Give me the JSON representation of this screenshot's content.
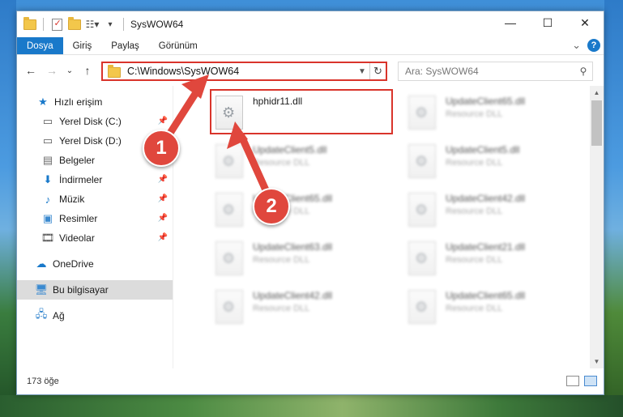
{
  "window": {
    "title": "SysWOW64",
    "controls": {
      "minimize": "—",
      "maximize": "☐",
      "close": "✕"
    }
  },
  "ribbon": {
    "tabs": [
      {
        "label": "Dosya",
        "active": true
      },
      {
        "label": "Giriş"
      },
      {
        "label": "Paylaş"
      },
      {
        "label": "Görünüm"
      }
    ],
    "expand": "⌄",
    "help": "?"
  },
  "nav": {
    "back": "←",
    "forward": "→",
    "recent": "⌄",
    "up": "↑",
    "address": "C:\\Windows\\SysWOW64",
    "search_placeholder": "Ara: SysWOW64"
  },
  "sidebar": {
    "items": [
      {
        "label": "Hızlı erişim",
        "icon": "star-icon",
        "pinned": false
      },
      {
        "label": "Yerel Disk (C:)",
        "icon": "drive-icon",
        "pinned": true
      },
      {
        "label": "Yerel Disk (D:)",
        "icon": "drive-icon",
        "pinned": true
      },
      {
        "label": "Belgeler",
        "icon": "documents-icon",
        "pinned": true
      },
      {
        "label": "İndirmeler",
        "icon": "download-icon",
        "pinned": true
      },
      {
        "label": "Müzik",
        "icon": "music-icon",
        "pinned": true
      },
      {
        "label": "Resimler",
        "icon": "pictures-icon",
        "pinned": true
      },
      {
        "label": "Videolar",
        "icon": "videos-icon",
        "pinned": true
      },
      {
        "label": "OneDrive",
        "icon": "cloud-icon",
        "pinned": false
      },
      {
        "label": "Bu bilgisayar",
        "icon": "computer-icon",
        "selected": true
      },
      {
        "label": "Ağ",
        "icon": "network-icon",
        "pinned": false
      }
    ]
  },
  "files": {
    "highlighted": {
      "name": "hphidr11.dll",
      "type": ""
    },
    "items": [
      {
        "name": "UpdateClient65.dll",
        "type": "Resource DLL"
      },
      {
        "name": "UpdateClient5.dll",
        "type": "Resource DLL"
      },
      {
        "name": "UpdateClient5.dll",
        "type": "Resource DLL"
      },
      {
        "name": "UpdateClient65.dll",
        "type": "Resource DLL"
      },
      {
        "name": "UpdateClient42.dll",
        "type": "Resource DLL"
      },
      {
        "name": "UpdateClient63.dll",
        "type": "Resource DLL"
      },
      {
        "name": "UpdateClient21.dll",
        "type": "Resource DLL"
      },
      {
        "name": "UpdateClient42.dll",
        "type": "Resource DLL"
      },
      {
        "name": "UpdateClient65.dll",
        "type": "Resource DLL"
      }
    ]
  },
  "status": {
    "count": "173 öğe"
  },
  "annotations": {
    "badge1": "1",
    "badge2": "2",
    "color": "#e0473d"
  }
}
